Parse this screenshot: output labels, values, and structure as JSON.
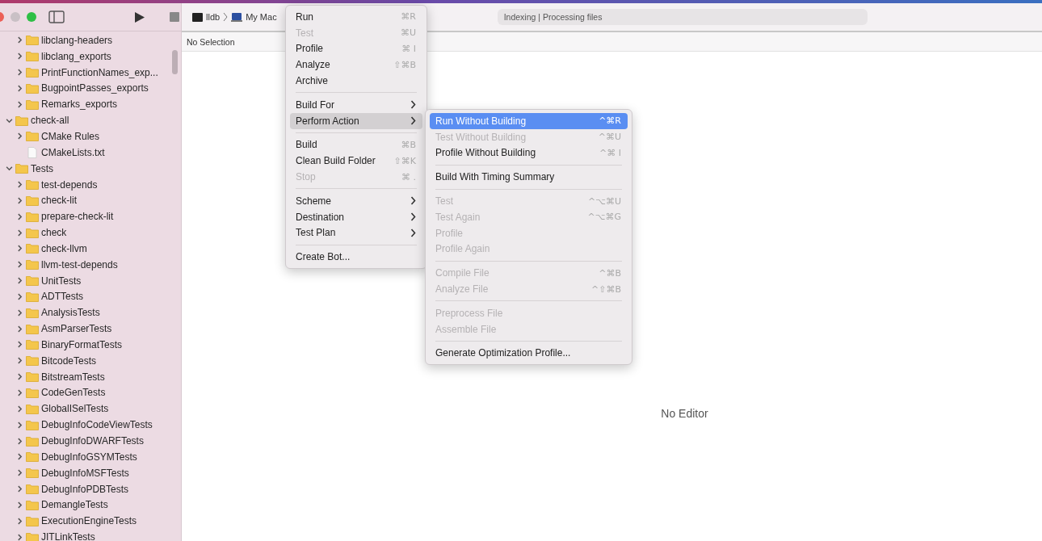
{
  "toolbar": {
    "scheme": "lldb",
    "destination": "My Mac",
    "activity": "Indexing | Processing files"
  },
  "navigator": {
    "tree": [
      {
        "children": [
          {
            "label": "libclang-headers",
            "kind": "folder",
            "expanded": false
          },
          {
            "label": "libclang_exports",
            "kind": "folder",
            "expanded": false
          },
          {
            "label": "PrintFunctionNames_exp...",
            "kind": "folder",
            "expanded": false
          },
          {
            "label": "BugpointPasses_exports",
            "kind": "folder",
            "expanded": false
          },
          {
            "label": "Remarks_exports",
            "kind": "folder",
            "expanded": false
          }
        ]
      },
      {
        "label": "check-all",
        "kind": "folder",
        "expanded": true,
        "children": [
          {
            "label": "CMake Rules",
            "kind": "folder",
            "expanded": false
          },
          {
            "label": "CMakeLists.txt",
            "kind": "file"
          }
        ]
      },
      {
        "label": "Tests",
        "kind": "folder",
        "expanded": true,
        "children": [
          {
            "label": "test-depends",
            "kind": "folder",
            "expanded": false
          },
          {
            "label": "check-lit",
            "kind": "folder",
            "expanded": false
          },
          {
            "label": "prepare-check-lit",
            "kind": "folder",
            "expanded": false
          },
          {
            "label": "check",
            "kind": "folder",
            "expanded": false
          },
          {
            "label": "check-llvm",
            "kind": "folder",
            "expanded": false
          },
          {
            "label": "llvm-test-depends",
            "kind": "folder",
            "expanded": false
          },
          {
            "label": "UnitTests",
            "kind": "folder",
            "expanded": false
          },
          {
            "label": "ADTTests",
            "kind": "folder",
            "expanded": false
          },
          {
            "label": "AnalysisTests",
            "kind": "folder",
            "expanded": false
          },
          {
            "label": "AsmParserTests",
            "kind": "folder",
            "expanded": false
          },
          {
            "label": "BinaryFormatTests",
            "kind": "folder",
            "expanded": false
          },
          {
            "label": "BitcodeTests",
            "kind": "folder",
            "expanded": false
          },
          {
            "label": "BitstreamTests",
            "kind": "folder",
            "expanded": false
          },
          {
            "label": "CodeGenTests",
            "kind": "folder",
            "expanded": false
          },
          {
            "label": "GlobalISelTests",
            "kind": "folder",
            "expanded": false
          },
          {
            "label": "DebugInfoCodeViewTests",
            "kind": "folder",
            "expanded": false
          },
          {
            "label": "DebugInfoDWARFTests",
            "kind": "folder",
            "expanded": false
          },
          {
            "label": "DebugInfoGSYMTests",
            "kind": "folder",
            "expanded": false
          },
          {
            "label": "DebugInfoMSFTests",
            "kind": "folder",
            "expanded": false
          },
          {
            "label": "DebugInfoPDBTests",
            "kind": "folder",
            "expanded": false
          },
          {
            "label": "DemangleTests",
            "kind": "folder",
            "expanded": false
          },
          {
            "label": "ExecutionEngineTests",
            "kind": "folder",
            "expanded": false
          },
          {
            "label": "JITLinkTests",
            "kind": "folder",
            "expanded": false
          }
        ]
      }
    ]
  },
  "jump_bar": "No Selection",
  "editor": {
    "empty_text": "No Editor"
  },
  "product_menu": {
    "sections": [
      [
        {
          "label": "Run",
          "shortcut": "⌘R",
          "disabled": false,
          "submenu": false,
          "selected": false
        },
        {
          "label": "Test",
          "shortcut": "⌘U",
          "disabled": true,
          "submenu": false,
          "selected": false
        },
        {
          "label": "Profile",
          "shortcut": "⌘ I",
          "disabled": false,
          "submenu": false,
          "selected": false
        },
        {
          "label": "Analyze",
          "shortcut": "⇧⌘B",
          "disabled": false,
          "submenu": false,
          "selected": false
        },
        {
          "label": "Archive",
          "disabled": false,
          "submenu": false,
          "selected": false
        }
      ],
      [
        {
          "label": "Build For",
          "disabled": false,
          "submenu": true,
          "selected": false
        },
        {
          "label": "Perform Action",
          "disabled": false,
          "submenu": true,
          "selected": true
        }
      ],
      [
        {
          "label": "Build",
          "shortcut": "⌘B",
          "disabled": false,
          "submenu": false,
          "selected": false
        },
        {
          "label": "Clean Build Folder",
          "shortcut": "⇧⌘K",
          "disabled": false,
          "submenu": false,
          "selected": false
        },
        {
          "label": "Stop",
          "shortcut": "⌘ .",
          "disabled": true,
          "submenu": false,
          "selected": false
        }
      ],
      [
        {
          "label": "Scheme",
          "disabled": false,
          "submenu": true,
          "selected": false
        },
        {
          "label": "Destination",
          "disabled": false,
          "submenu": true,
          "selected": false
        },
        {
          "label": "Test Plan",
          "disabled": false,
          "submenu": true,
          "selected": false
        }
      ],
      [
        {
          "label": "Create Bot...",
          "disabled": false,
          "submenu": false,
          "selected": false
        }
      ]
    ]
  },
  "perform_action_menu": {
    "sections": [
      [
        {
          "label": "Run Without Building",
          "shortcut": "^⌘R",
          "disabled": false,
          "submenu": false,
          "selected": true
        },
        {
          "label": "Test Without Building",
          "shortcut": "^⌘U",
          "disabled": true,
          "submenu": false,
          "selected": false
        },
        {
          "label": "Profile Without Building",
          "shortcut": "^⌘ I",
          "disabled": false,
          "submenu": false,
          "selected": false
        }
      ],
      [
        {
          "label": "Build With Timing Summary",
          "disabled": false,
          "submenu": false,
          "selected": false
        }
      ],
      [
        {
          "label": "Test",
          "shortcut": "^⌥⌘U",
          "disabled": true,
          "submenu": false,
          "selected": false
        },
        {
          "label": "Test Again",
          "shortcut": "^⌥⌘G",
          "disabled": true,
          "submenu": false,
          "selected": false
        },
        {
          "label": "Profile",
          "disabled": true,
          "submenu": false,
          "selected": false
        },
        {
          "label": "Profile Again",
          "disabled": true,
          "submenu": false,
          "selected": false
        }
      ],
      [
        {
          "label": "Compile File",
          "shortcut": "^⌘B",
          "disabled": true,
          "submenu": false,
          "selected": false
        },
        {
          "label": "Analyze File",
          "shortcut": "^⇧⌘B",
          "disabled": true,
          "submenu": false,
          "selected": false
        }
      ],
      [
        {
          "label": "Preprocess File",
          "disabled": true,
          "submenu": false,
          "selected": false
        },
        {
          "label": "Assemble File",
          "disabled": true,
          "submenu": false,
          "selected": false
        }
      ],
      [
        {
          "label": "Generate Optimization Profile...",
          "disabled": false,
          "submenu": false,
          "selected": false
        }
      ]
    ]
  }
}
